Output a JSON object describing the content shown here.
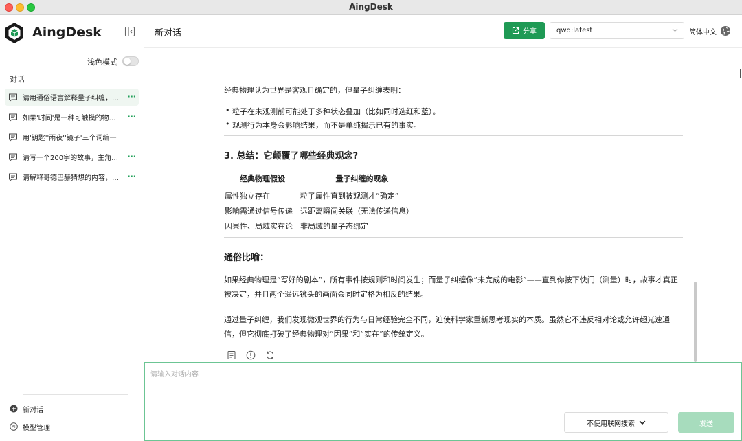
{
  "window": {
    "title": "AingDesk"
  },
  "sidebar": {
    "brand": "AingDesk",
    "theme_label": "浅色模式",
    "theme_light_enabled": false,
    "section_label": "对话",
    "conversations": [
      {
        "title": "请用通俗语言解释量子纠缠，…",
        "active": true
      },
      {
        "title": "如果'时间'是一种可触摸的物…",
        "active": false
      },
      {
        "title": "用'钥匙''雨夜''镜子'三个词编一",
        "active": false
      },
      {
        "title": "请写一个200字的故事，主角…",
        "active": false
      },
      {
        "title": "请解释哥德巴赫猜想的内容，…",
        "active": false
      }
    ],
    "more_label": "···",
    "footer": {
      "new_chat": "新对话",
      "model_manage": "模型管理"
    }
  },
  "header": {
    "title": "新对话",
    "share_label": "分享",
    "model_value": "qwq:latest",
    "language": "简体中文"
  },
  "chat": {
    "intro": "经典物理认为世界是客观且确定的，但量子纠缠表明：",
    "bullets": [
      "粒子在未观测前可能处于多种状态叠加（比如同时选红和蓝）。",
      "观测行为本身会影响结果，而不是单纯揭示已有的事实。"
    ],
    "section3_title": "3. 总结：它颠覆了哪些经典观念?",
    "table": {
      "headers": [
        "经典物理假设",
        "量子纠缠的现象"
      ],
      "rows": [
        [
          "属性独立存在",
          "粒子属性直到被观测才“确定”"
        ],
        [
          "影响需通过信号传递",
          "远距离瞬间关联（无法传递信息）"
        ],
        [
          "因果性、局域实在论",
          "非局域的量子态绑定"
        ]
      ]
    },
    "analogy_title": "通俗比喻：",
    "analogy": "如果经典物理是“写好的剧本”，所有事件按规则和时间发生；而量子纠缠像“未完成的电影”——直到你按下快门（测量）时，故事才真正被决定，并且两个遥远镜头的画面会同时定格为相反的结果。",
    "conclusion": "通过量子纠缠，我们发现微观世界的行为与日常经验完全不同，迫使科学家重新思考现实的本质。虽然它不违反相对论或允许超光速通信，但它彻底打破了经典物理对“因果”和“实在”的传统定义。"
  },
  "input": {
    "placeholder": "请输入对话内容",
    "value": "",
    "search_toggle_label": "不使用联网搜索",
    "send_label": "发送"
  },
  "colors": {
    "accent": "#1f9a55",
    "send_disabled": "#a7dcbd",
    "active_item_bg": "#eff6f1"
  }
}
